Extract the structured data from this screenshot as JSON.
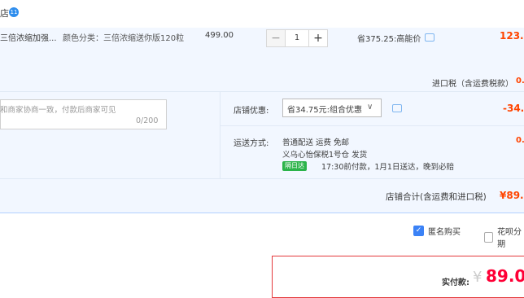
{
  "header": {
    "shop_tag": "店",
    "badge": "11"
  },
  "item": {
    "name": "三倍浓缩加强...",
    "sku": "颜色分类：三倍浓缩送你版120粒",
    "price": "499.00",
    "quantity": "1",
    "minus": "−",
    "plus": "+",
    "saving": "省375.25:高能价",
    "total": "123."
  },
  "tax": {
    "label": "进口税（含运费税款）",
    "value": "0."
  },
  "message": {
    "placeholder": "和商家协商一致，付款后商家可见",
    "count": "0/200"
  },
  "discount": {
    "label": "店铺优惠:",
    "selected": "省34.75元:组合优惠",
    "arrow": "∨",
    "value": "-34."
  },
  "shipping": {
    "label": "运送方式:",
    "line1": "普通配送 运费 免邮",
    "line2": "义乌心怡保税1号仓   发货",
    "badge": "隔日达",
    "note": "17:30前付款，1月1日送达，晚到必赔",
    "value": "0."
  },
  "shop_total": {
    "label": "店铺合计(含运费和进口税)",
    "value": "¥89."
  },
  "options": {
    "anonymous": "匿名购买",
    "huabei": "花呗分期"
  },
  "payment": {
    "label": "实付款:",
    "currency": "¥",
    "amount": "89.0"
  },
  "colors": {
    "accent": "#ff4400",
    "pay": "#ff0036",
    "rowbg": "#f2f7ff",
    "checkbox": "#3b82f6"
  },
  "icons": [
    "chat-icon",
    "chat-icon",
    "check-icon"
  ]
}
